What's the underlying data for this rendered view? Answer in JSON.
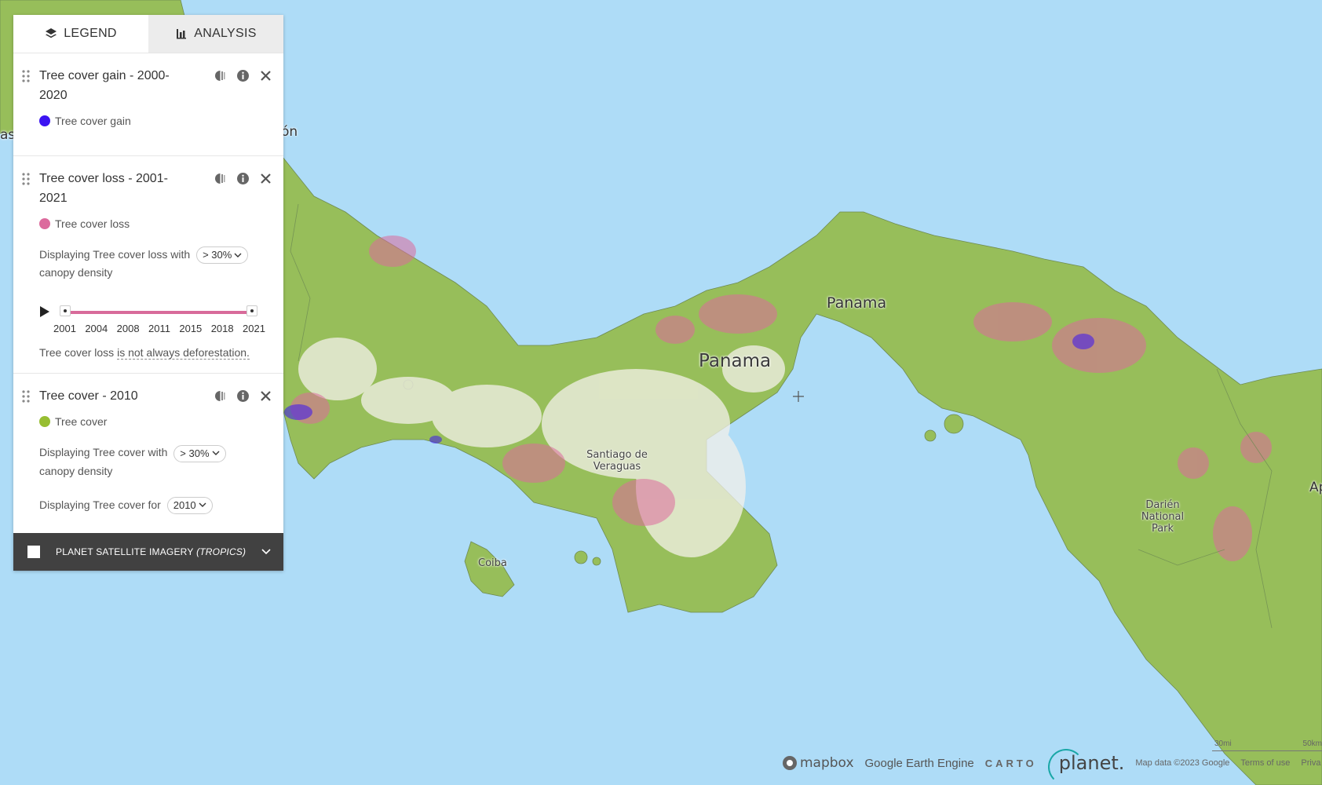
{
  "tabs": {
    "legend": "LEGEND",
    "analysis": "ANALYSIS"
  },
  "layers": [
    {
      "title": "Tree cover gain - 2000-2020",
      "legend_label": "Tree cover gain",
      "color": "#3b14f2"
    },
    {
      "title": "Tree cover loss - 2001-2021",
      "legend_label": "Tree cover loss",
      "color": "#dc6a9d",
      "display_prefix": "Displaying Tree cover loss with",
      "density_value": "> 30%",
      "display_suffix": "canopy density",
      "years": [
        "2001",
        "2004",
        "2008",
        "2011",
        "2015",
        "2018",
        "2021"
      ],
      "note_prefix": "Tree cover loss ",
      "note_link": "is not always deforestation."
    },
    {
      "title": "Tree cover - 2010",
      "legend_label": "Tree cover",
      "color": "#97be32",
      "display_prefix": "Displaying Tree cover with",
      "density_value": "> 30%",
      "display_suffix": "canopy density",
      "year_prefix": "Displaying Tree cover for",
      "year_value": "2010"
    }
  ],
  "planet": {
    "label": "PLANET SATELLITE IMAGERY",
    "label_italic": "(TROPICS)"
  },
  "map_labels": {
    "country": "Panama",
    "capital": "Panama",
    "santiago": "Santiago de Veraguas",
    "coiba": "Coiba",
    "darien": "Darién National Park",
    "edge_left_a": "as",
    "edge_left_b": "ón",
    "edge_right": "Ap"
  },
  "attribution": {
    "mapbox": "mapbox",
    "gee": "Google Earth Engine",
    "carto": "CARTO",
    "planet": "planet.",
    "mapdata": "Map data ©2023 Google",
    "terms": "Terms of use",
    "privacy": "Priva"
  },
  "scale": {
    "imperial": "30mi",
    "metric": "50km"
  },
  "colors": {
    "water": "#aedcf7",
    "land": "#97be5a",
    "loss": "#dc6a9d",
    "gain": "#3b14f2",
    "panel_bar": "#414141"
  }
}
